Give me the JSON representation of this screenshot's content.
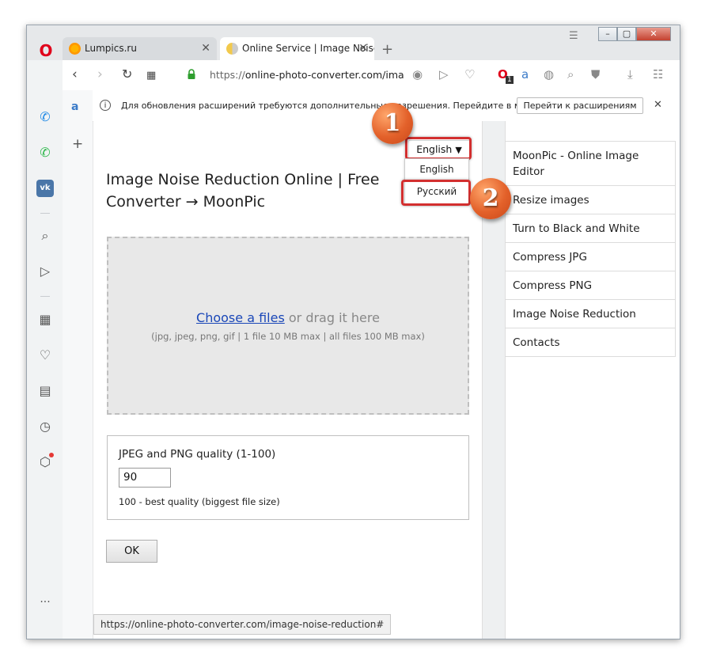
{
  "browser": {
    "logo": "O",
    "tabs": [
      {
        "title": "Lumpics.ru",
        "close": "✕"
      },
      {
        "title": "Online Service | Image Noise",
        "close": "✕"
      }
    ],
    "new_tab": "+",
    "url_scheme": "https://",
    "url_rest": "online-photo-converter.com/ima",
    "window_controls": {
      "minimize": "–",
      "maximize": "▢",
      "close": "✕"
    },
    "toolbar_badge": "1"
  },
  "sidebar": {
    "items": [
      "messenger-icon",
      "whatsapp-icon",
      "vk-icon",
      "search-icon",
      "send-icon",
      "speed-dial-icon",
      "heart-icon",
      "news-icon",
      "history-icon",
      "extensions-icon",
      "more-icon"
    ]
  },
  "notification": {
    "text": "Для обновления расширений требуются дополнительные разрешения. Перейдите в ме...",
    "button": "Перейти к расширениям",
    "close": "✕"
  },
  "page": {
    "title": "Image Noise Reduction Online | Free Converter → MoonPic",
    "language_selector": {
      "value": "English",
      "arrow": "▼"
    },
    "language_options": [
      "English",
      "Русский"
    ],
    "dropzone": {
      "link": "Choose a files",
      "text": " or drag it here",
      "formats": "(jpg, jpeg, png, gif | 1 file 10 MB max | all files 100 MB max)"
    },
    "quality": {
      "label": "JPEG and PNG quality (1-100)",
      "value": "90",
      "hint": "100 - best quality (biggest file size)"
    },
    "ok_button": "OK",
    "menu": [
      "MoonPic - Online Image Editor",
      "Resize images",
      "Turn to Black and White",
      "Compress JPG",
      "Compress PNG",
      "Image Noise Reduction",
      "Contacts"
    ]
  },
  "status_url": "https://online-photo-converter.com/image-noise-reduction#",
  "badges": [
    "1",
    "2"
  ],
  "colors": {
    "highlight": "#d32f2f",
    "badge": "#e3612a",
    "link": "#1a47b8"
  }
}
